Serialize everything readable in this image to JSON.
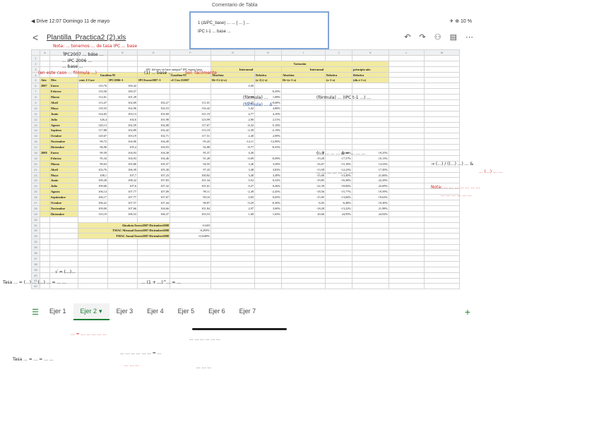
{
  "status": {
    "left": "◀ Drive 12:07 Domingo 11 de mayo",
    "right": "✈ ⊕ 10 %"
  },
  "toolbar": {
    "back_label": "<",
    "file_title": "Plantilla_Practica2 (2).xls",
    "icons": [
      "undo-icon",
      "redo-icon",
      "add-person-icon",
      "comment-icon",
      "more-icon"
    ],
    "icon_glyphs": [
      "↶",
      "↷",
      "⚇",
      "▤",
      "⋯"
    ]
  },
  "note_box": {
    "title": "Comentario de Tabla",
    "line1": "1 (ΔIPC_base) ... ... { ... } ... ",
    "line2": "IPC t-1 ... base ..."
  },
  "sheet": {
    "columns": [
      "",
      "A",
      "B",
      "C",
      "D",
      "E",
      "F",
      "G",
      "H",
      "I",
      "J",
      "K",
      "L",
      "M"
    ],
    "header_rows": {
      "r2_variacion": "Variación",
      "r3_interanual": "Interanual",
      "r3_interanual2": "Interanual",
      "r3_principio": "principio año",
      "r4_gasolina": "Gasolina 95",
      "r4_gasolina2": "Gasolina 95",
      "r4_absoluta": "Absoluta",
      "r4_relativa": "Relativa",
      "r4_absoluta2": "Absoluta",
      "r4_relativa2": "Relativa",
      "r4_relativa3": "Relativa",
      "r4_ipc": "IPC del mes en base antigua* IPC marzo base",
      "r5_anio": "Año",
      "r5_mes": "Mes",
      "r5_cent": "cent. € Corr",
      "r5_ipc2006": "IPC2006=1",
      "r5_ipcenero": "IPCEnero2007=1",
      "r5_const": "c€ Ctes E2007",
      "r5_dt": "Dt=Ct-(t-x)",
      "r5_rt": "(x-1)-(-x)",
      "r5_dt2": "Dt=(x-1-x)",
      "r5_rt2": "(x-1-x)",
      "r5_dic": "(dic.t-1-x)"
    },
    "rows": [
      {
        "year": "2007",
        "month": "Enero",
        "c": "110,76",
        "d": "100,42",
        "e": "",
        "f": "",
        "g": "0,00",
        "h": "",
        "i": "",
        "j": "",
        "k": ""
      },
      {
        "year": "",
        "month": "Febrero",
        "c": "110,56",
        "d": "100,57",
        "e": "",
        "f": "",
        "g": "",
        "h": "-0,29%",
        "i": "",
        "j": "",
        "k": ""
      },
      {
        "year": "",
        "month": "Marzo",
        "c": "112,61",
        "d": "101,29",
        "e": "",
        "f": "",
        "g": "1,19",
        "h": "1,08%",
        "i": "",
        "j": "",
        "k": ""
      },
      {
        "year": "",
        "month": "Abril",
        "c": "113,47",
        "d": "102,69",
        "e": "102,27",
        "f": "111,01",
        "g": "-0,47",
        "h": "-0,68%",
        "i": "",
        "j": "",
        "k": ""
      },
      {
        "year": "",
        "month": "Mayo",
        "c": "118,33",
        "d": "102,96",
        "e": "102,53",
        "f": "116,42",
        "g": "5,42",
        "h": "4,88%",
        "i": "",
        "j": "",
        "k": ""
      },
      {
        "year": "",
        "month": "Junio",
        "c": "124,65",
        "d": "103,13",
        "e": "102,69",
        "f": "121,19",
        "g": "4,77",
        "h": "4,10%",
        "i": "",
        "j": "",
        "k": ""
      },
      {
        "year": "",
        "month": "Julio",
        "c": "126,4",
        "d": "102,6",
        "e": "101,98",
        "f": "123,99",
        "g": "2,80",
        "h": "2,31%",
        "i": "",
        "j": "",
        "k": ""
      },
      {
        "year": "",
        "month": "Agosto",
        "c": "120,13",
        "d": "102,59",
        "e": "102,08",
        "f": "117,67",
        "g": "-6,32",
        "h": "-5,10%",
        "i": "",
        "j": "",
        "k": ""
      },
      {
        "year": "",
        "month": "Septiem",
        "c": "117,88",
        "d": "102,89",
        "e": "102,42",
        "f": "115,10",
        "g": "-2,58",
        "h": "-2,19%",
        "i": "",
        "j": "",
        "k": ""
      },
      {
        "year": "",
        "month": "Octubre",
        "c": "120,67",
        "d": "103,19",
        "e": "102,71",
        "f": "117,51",
        "g": "2,40",
        "h": "2,09%",
        "i": "",
        "j": "",
        "k": ""
      },
      {
        "year": "",
        "month": "Noviembre",
        "c": "99,72",
        "d": "104,96",
        "e": "104,49",
        "f": "95,43",
        "g": "-14,11",
        "h": "-12,90%",
        "i": "",
        "j": "",
        "k": ""
      },
      {
        "year": "",
        "month": "Diciembre",
        "c": "96,96",
        "d": "105,4",
        "e": "104,93",
        "f": "92,88",
        "g": "-8,77",
        "h": "-8,55%",
        "i": "",
        "j": "",
        "k": ""
      },
      {
        "year": "2008",
        "month": "Enero",
        "c": "99,39",
        "d": "104,93",
        "e": "104,38",
        "f": "95,37",
        "g": "4,49",
        "h": "",
        "i": "-15,38",
        "j": "-13,63%",
        "k": "10,25%"
      },
      {
        "year": "",
        "month": "Febrero",
        "c": "95,34",
        "d": "104,93",
        "e": "104,46",
        "f": "91,28",
        "g": "-0,09",
        "h": "-0,09%",
        "i": "-19,28",
        "j": "-17,37%",
        "k": "10,13%"
      },
      {
        "year": "",
        "month": "Marzo",
        "c": "99,63",
        "d": "105,86",
        "e": "105,37",
        "f": "94,55",
        "g": "3,46",
        "h": "3,58%",
        "i": "-16,67",
        "j": "-15,18%",
        "k": "14,33%"
      },
      {
        "year": "",
        "month": "Abril",
        "c": "103,76",
        "d": "106,39",
        "e": "105,30",
        "f": "97,43",
        "g": "3,48",
        "h": "3,83%",
        "i": "-13,58",
        "j": "-12,23%",
        "k": "17,50%"
      },
      {
        "year": "",
        "month": "Mayo",
        "c": "108,1",
        "d": "107,7",
        "e": "107,23",
        "f": "100,82",
        "g": "3,40",
        "h": "3,49%",
        "i": "-15,60",
        "j": "-13,40%",
        "k": "21,66%"
      },
      {
        "year": "",
        "month": "Junio",
        "c": "109,28",
        "d": "108,32",
        "e": "107,83",
        "f": "101,34",
        "g": "0,52",
        "h": "0,52%",
        "i": "-19,85",
        "j": "-16,38%",
        "k": "22,29%"
      },
      {
        "year": "",
        "month": "Julio",
        "c": "109,66",
        "d": "107,6",
        "e": "107,32",
        "f": "101,61",
        "g": "0,27",
        "h": "0,26%",
        "i": "-22,39",
        "j": "-18,06%",
        "k": "22,69%"
      },
      {
        "year": "",
        "month": "Agosto",
        "c": "106,14",
        "d": "107,77",
        "e": "107,09",
        "f": "99,11",
        "g": "-2,49",
        "h": "-2,45%",
        "i": "-18,56",
        "j": "-15,77%",
        "k": "19,59%"
      },
      {
        "year": "",
        "month": "Septiembre",
        "c": "106,17",
        "d": "107,77",
        "e": "107,07",
        "f": "99,16",
        "g": "0,05",
        "h": "0,05%",
        "i": "-15,95",
        "j": "-13,84%",
        "k": "19,63%"
      },
      {
        "year": "",
        "month": "Octubre",
        "c": "106,22",
        "d": "107,57",
        "e": "107,44",
        "f": "98,87",
        "g": "-0,29",
        "h": "-0,30%",
        "i": "-6,05",
        "j": "-6,48%",
        "k": "19,30%"
      },
      {
        "year": "",
        "month": "Noviembre",
        "c": "109,00",
        "d": "107,66",
        "e": "104,66",
        "f": "101,84",
        "g": "2,97",
        "h": "3,00%",
        "i": "-18,28",
        "j": "-13,22%",
        "k": "21,98%"
      },
      {
        "year": "",
        "month": "Diciembre",
        "c": "110,19",
        "d": "106,53",
        "e": "106,37",
        "f": "103,53",
        "g": "1,68",
        "h": "1,65%",
        "i": "20,66",
        "j": "24,95%",
        "k": "24,92%"
      }
    ],
    "summary": [
      {
        "label": "Absoluta Enero2007-Diciembre2008",
        "value": "-0,603"
      },
      {
        "label": "TMAC Mensual Enero2007-Diciembre2008",
        "value": "-0,293%"
      },
      {
        "label": "TMAC Anual Enero2007-Diciembre2008",
        "value": "-4,5248%"
      }
    ]
  },
  "tabs": {
    "items": [
      "Ejer 1",
      "Ejer 2",
      "Ejer 3",
      "Ejer 4",
      "Ejer 5",
      "Ejer 6",
      "Ejer 7"
    ],
    "active_index": 1,
    "add_label": "+",
    "menu_label": "☰",
    "dropdown": "▾"
  },
  "annotations": {
    "a1": "Nota: ... tenemos ... de tasa IPC ... base",
    "a2": "IPC2007 ... base ...",
    "a3": "... IPC 2006 ...",
    "a4": "... base ...",
    "a5": "(en este caso ... fórmula ...)",
    "a6": "(1) ... base ...",
    "a7": "Sol: fácilmente",
    "a8": "(fórmula) ...",
    "a9": "(fórmula) ... Δ ...",
    "a10": "(fórmula) ... (IPC t-1 ...) ...",
    "a11": "→ (...) / ((...) ...) ... &",
    "a12": "... (...) ... ...",
    "a13": "Nota: ... ... ... ... ... ... ...",
    "a14": "... ... ... ... ... ...",
    "a15": "(...) ... ... ... Δ = ... ... ...",
    "a16": "... ... ... ... ... ... ...",
    "a17": "√ = (...)...",
    "a18": "Tasa ... = (...) ... (...) ... = ... ...",
    "a19": "... (1 + ...)^... = ...",
    "a20": "... = ... ... ... ... ...",
    "a21": "... ... ... ... ... ...",
    "a22": "Tasa ... = ... = ... ...",
    "a23": "... ... ... ... ... ... = ...",
    "a24": "... ... ...",
    "a25": "... ... ..."
  }
}
